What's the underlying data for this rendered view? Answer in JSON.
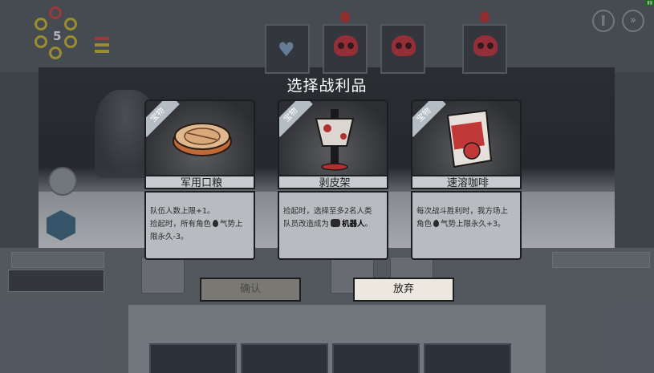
{
  "hud": {
    "dice_count": "5",
    "status_bar_colors": [
      "#d84040",
      "#d8c030",
      "#d8c030"
    ],
    "settings_icons": [
      "pause-icon",
      "speed-icon"
    ]
  },
  "modal": {
    "title": "选择战利品",
    "cards": [
      {
        "tag": "宝物",
        "name": "军用口粮",
        "desc_lines": [
          "队伍人数上限+1。",
          "捡起时，所有角色",
          "气势上",
          "限永久-3。"
        ]
      },
      {
        "tag": "宝物",
        "name": "剥皮架",
        "desc_lines": [
          "捡起时，选择至多2名人类",
          "队员改造成为",
          "机器人",
          "。"
        ]
      },
      {
        "tag": "宝物",
        "name": "速溶咖啡",
        "desc_lines": [
          "每次战斗胜利时，我方场上",
          "角色",
          "气势上限永久+3。"
        ]
      }
    ],
    "confirm_label": "确认",
    "abandon_label": "放弃"
  },
  "colors": {
    "enemy_skull": "#d0303a",
    "card_desc_bg": "#b8bcc0",
    "abandon_bg": "#ece8e0",
    "confirm_bg": "#7a7872"
  }
}
